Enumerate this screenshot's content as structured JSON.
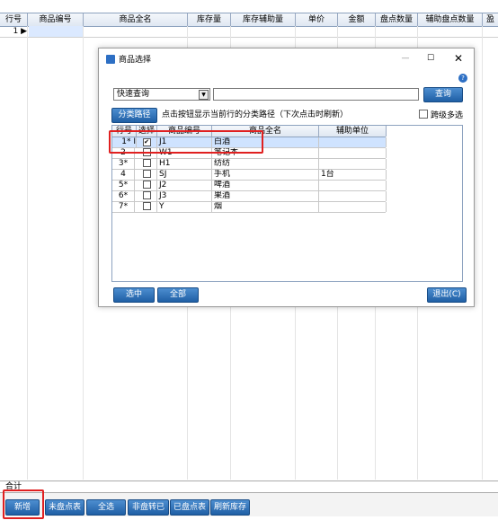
{
  "main": {
    "columns": [
      "行号",
      "商品编号",
      "商品全名",
      "库存量",
      "库存辅助量",
      "单价",
      "金额",
      "盘点数量",
      "辅助盘点数量",
      "盈"
    ],
    "row1_no": "1 ▶",
    "total_label": "合计"
  },
  "toolbar": {
    "buttons": [
      "新增",
      "未盘点表",
      "全选",
      "非盘转已盘",
      "已盘点表",
      "刷新库存"
    ]
  },
  "dialog": {
    "title": "商品选择",
    "min": "—",
    "max": "☐",
    "close": "✕",
    "help": "?",
    "combo_value": "快速查询",
    "query_button": "查询",
    "category_button": "分类路径",
    "hint": "点击按钮显示当前行的分类路径（下次点击时刷新）",
    "multi_label": "跨级多选",
    "columns": [
      "行号",
      "选择",
      "商品编号",
      "商品全名",
      "辅助单位"
    ],
    "rows": [
      {
        "no": "1* I",
        "check": "✔",
        "code": "J1",
        "name": "白酒",
        "aux": ""
      },
      {
        "no": "2",
        "check": "",
        "code": "W1",
        "name": "笔记本",
        "aux": ""
      },
      {
        "no": "3*",
        "check": "",
        "code": "H1",
        "name": "纺纺",
        "aux": ""
      },
      {
        "no": "4",
        "check": "",
        "code": "SJ",
        "name": "手机",
        "aux": "1台"
      },
      {
        "no": "5*",
        "check": "",
        "code": "J2",
        "name": "啤酒",
        "aux": ""
      },
      {
        "no": "6*",
        "check": "",
        "code": "J3",
        "name": "果酒",
        "aux": ""
      },
      {
        "no": "7*",
        "check": "",
        "code": "Y",
        "name": "烟",
        "aux": ""
      }
    ],
    "select_button": "选中",
    "all_button": "全部",
    "exit_button": "退出(C)"
  },
  "colors": {
    "accent": "#2b6cb8",
    "highlight": "#e02020",
    "selected_row": "#cfe3ff"
  }
}
